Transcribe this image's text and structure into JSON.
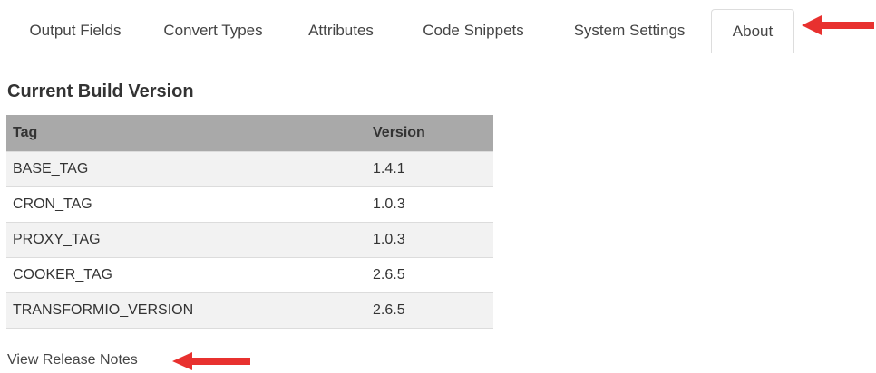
{
  "tabs": [
    {
      "label": "Output Fields"
    },
    {
      "label": "Convert Types"
    },
    {
      "label": "Attributes"
    },
    {
      "label": "Code Snippets"
    },
    {
      "label": "System Settings"
    },
    {
      "label": "About",
      "active": true
    }
  ],
  "section_title": "Current Build Version",
  "table": {
    "headers": [
      "Tag",
      "Version"
    ],
    "rows": [
      [
        "BASE_TAG",
        "1.4.1"
      ],
      [
        "CRON_TAG",
        "1.0.3"
      ],
      [
        "PROXY_TAG",
        "1.0.3"
      ],
      [
        "COOKER_TAG",
        "2.6.5"
      ],
      [
        "TRANSFORMIO_VERSION",
        "2.6.5"
      ]
    ]
  },
  "release_notes_link": "View Release Notes",
  "colors": {
    "header_bg": "#a9a9a9",
    "stripe_bg": "#f2f2f2",
    "arrow": "#e8312f"
  },
  "icons": [
    "right-arrow-annotation-icon",
    "left-arrow-annotation-icon"
  ]
}
